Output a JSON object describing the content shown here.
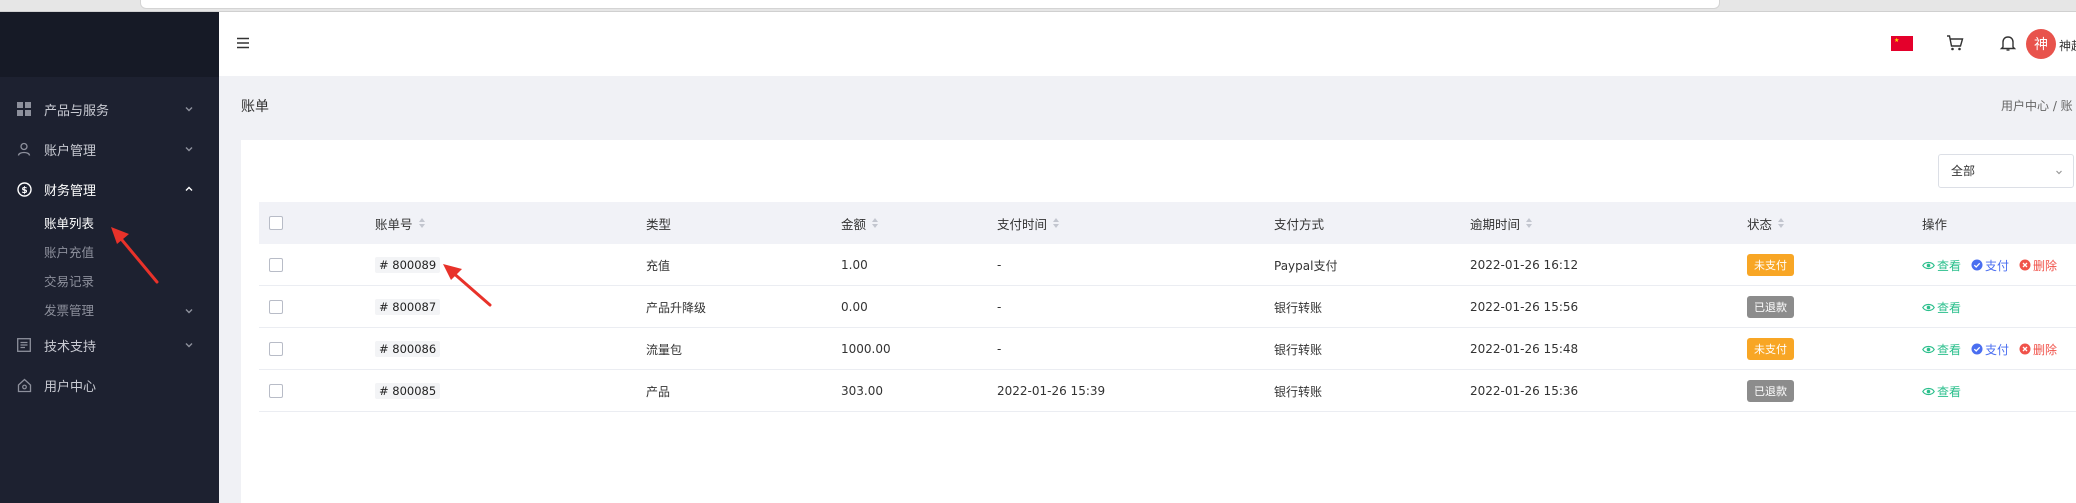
{
  "sidebar": {
    "menu": [
      {
        "label": "产品与服务",
        "icon": "grid-icon",
        "expanded": false
      },
      {
        "label": "账户管理",
        "icon": "user-icon",
        "expanded": false
      },
      {
        "label": "财务管理",
        "icon": "dollar-icon",
        "expanded": true
      },
      {
        "label": "技术支持",
        "icon": "document-icon",
        "expanded": false
      },
      {
        "label": "用户中心",
        "icon": "home-icon",
        "expanded": false
      }
    ],
    "finance_submenu": [
      {
        "label": "账单列表",
        "active": true
      },
      {
        "label": "账户充值",
        "active": false
      },
      {
        "label": "交易记录",
        "active": false
      },
      {
        "label": "发票管理",
        "active": false
      }
    ]
  },
  "header": {
    "avatar_initial": "神",
    "username": "神起"
  },
  "page": {
    "title": "账单",
    "breadcrumb": "用户中心 / 账"
  },
  "filter": {
    "selected": "全部"
  },
  "table": {
    "columns": [
      "账单号",
      "类型",
      "金额",
      "支付时间",
      "支付方式",
      "逾期时间",
      "状态",
      "操作"
    ],
    "rows": [
      {
        "bill_no": "# 800089",
        "type": "充值",
        "amount": "1.00",
        "pay_time": "-",
        "pay_method": "Paypal支付",
        "due_time": "2022-01-26 16:12",
        "status": "未支付",
        "status_kind": "unpaid"
      },
      {
        "bill_no": "# 800087",
        "type": "产品升降级",
        "amount": "0.00",
        "pay_time": "-",
        "pay_method": "银行转账",
        "due_time": "2022-01-26 15:56",
        "status": "已退款",
        "status_kind": "refunded"
      },
      {
        "bill_no": "# 800086",
        "type": "流量包",
        "amount": "1000.00",
        "pay_time": "-",
        "pay_method": "银行转账",
        "due_time": "2022-01-26 15:48",
        "status": "未支付",
        "status_kind": "unpaid"
      },
      {
        "bill_no": "# 800085",
        "type": "产品",
        "amount": "303.00",
        "pay_time": "2022-01-26 15:39",
        "pay_method": "银行转账",
        "due_time": "2022-01-26 15:36",
        "status": "已退款",
        "status_kind": "refunded"
      }
    ],
    "actions": {
      "view": "查看",
      "pay": "支付",
      "delete": "删除"
    }
  },
  "colors": {
    "sidebar_bg": "#1d2130",
    "unpaid": "#f8a625",
    "refunded": "#8c8c8c",
    "view": "#2bbf8c",
    "pay": "#4a6ef0",
    "delete": "#f0524a",
    "annotation": "#e8322a"
  }
}
